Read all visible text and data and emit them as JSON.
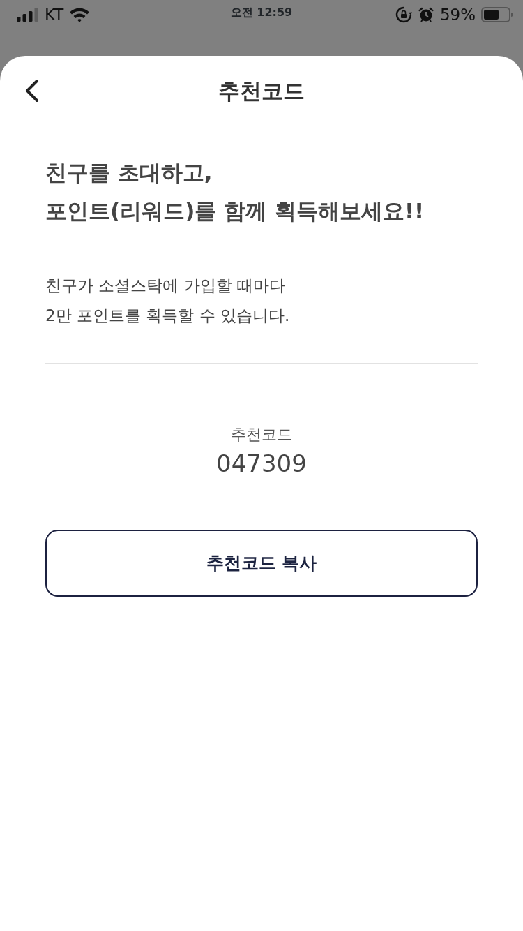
{
  "status_bar": {
    "carrier": "KT",
    "time": "오전 12:59",
    "battery": "59%"
  },
  "sheet": {
    "title": "추천코드",
    "headline": "친구를 초대하고,\n포인트(리워드)를 함께 획득해보세요!!",
    "description": "친구가 소셜스탁에 가입할 때마다\n2만 포인트를 획득할 수 있습니다.",
    "code_label": "추천코드",
    "code": "047309",
    "copy_button": "추천코드 복사"
  }
}
